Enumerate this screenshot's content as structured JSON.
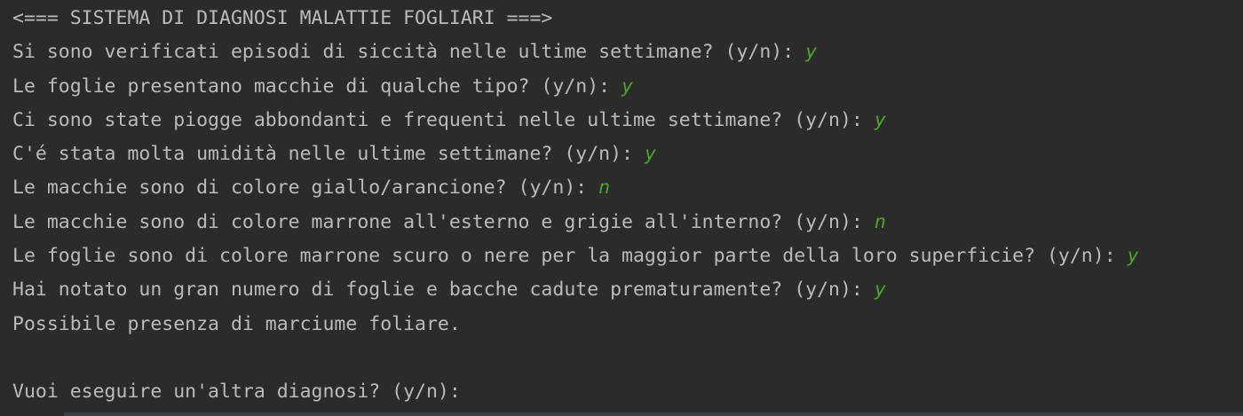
{
  "console": {
    "header": "<=== SISTEMA DI DIAGNOSI MALATTIE FOGLIARI ===>",
    "qa": [
      {
        "question": "Si sono verificati episodi di siccità nelle ultime settimane? (y/n): ",
        "answer": "y"
      },
      {
        "question": "Le foglie presentano macchie di qualche tipo? (y/n): ",
        "answer": "y"
      },
      {
        "question": "Ci sono state piogge abbondanti e frequenti nelle ultime settimane? (y/n): ",
        "answer": "y"
      },
      {
        "question": "C'é stata molta umidità nelle ultime settimane? (y/n): ",
        "answer": "y"
      },
      {
        "question": "Le macchie sono di colore giallo/arancione? (y/n): ",
        "answer": "n"
      },
      {
        "question": "Le macchie sono di colore marrone all'esterno e grigie all'interno? (y/n): ",
        "answer": "n"
      },
      {
        "question": "Le foglie sono di colore marrone scuro o nere per la maggior parte della loro superficie? (y/n): ",
        "answer": "y"
      },
      {
        "question": "Hai notato un gran numero di foglie e bacche cadute prematuramente? (y/n): ",
        "answer": "y"
      }
    ],
    "result": "Possibile presenza di marciume foliare.",
    "prompt": "Vuoi eseguire un'altra diagnosi? (y/n): "
  },
  "colors": {
    "background": "#2b2b2b",
    "text": "#bbbbbb",
    "user_input": "#4ca42e"
  }
}
